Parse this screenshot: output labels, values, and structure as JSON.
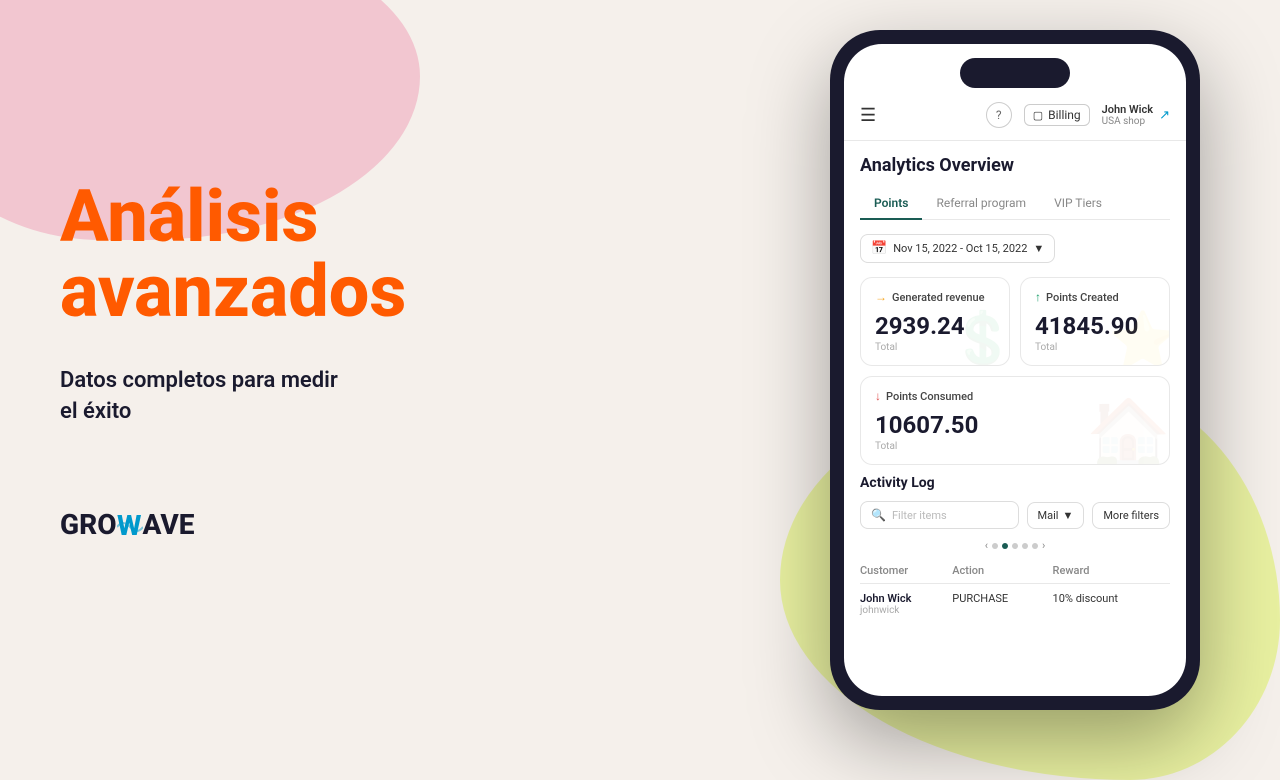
{
  "background": {
    "blob_pink_color": "#f2c6d0",
    "blob_yellow_color": "#e8f0a0"
  },
  "left": {
    "headline_line1": "Análisis",
    "headline_line2": "avanzados",
    "subtext_line1": "Datos completos para medir",
    "subtext_line2": "el éxito",
    "logo_part1": "GRO",
    "logo_part2": "W",
    "logo_part3": "AVE"
  },
  "app": {
    "header": {
      "help_label": "?",
      "billing_label": "Billing",
      "user_name": "John Wick",
      "user_shop": "USA shop"
    },
    "page_title": "Analytics Overview",
    "tabs": [
      {
        "label": "Points",
        "active": true
      },
      {
        "label": "Referral program",
        "active": false
      },
      {
        "label": "VIP Tiers",
        "active": false
      }
    ],
    "date_range": "Nov 15, 2022 - Oct 15, 2022",
    "stats": [
      {
        "id": "generated-revenue",
        "label": "Generated revenue",
        "value": "2939.24",
        "sublabel": "Total",
        "arrow": "side",
        "bg_icon": "💰"
      },
      {
        "id": "points-created",
        "label": "Points Created",
        "value": "41845.90",
        "sublabel": "Total",
        "arrow": "up",
        "bg_icon": "⭐"
      },
      {
        "id": "points-consumed",
        "label": "Points Consumed",
        "value": "10607.50",
        "sublabel": "Total",
        "arrow": "down",
        "bg_icon": "🏠"
      }
    ],
    "activity_log": {
      "title": "Activity Log",
      "search_placeholder": "Filter items",
      "filter_label": "Mail",
      "more_filters_label": "More filters",
      "pagination_dots": 5,
      "table_headers": [
        "Customer",
        "Action",
        "Reward"
      ],
      "table_rows": [
        {
          "customer_name": "John Wick",
          "customer_email": "johnwick",
          "action": "PURCHASE",
          "reward": "10% discount"
        }
      ]
    }
  }
}
